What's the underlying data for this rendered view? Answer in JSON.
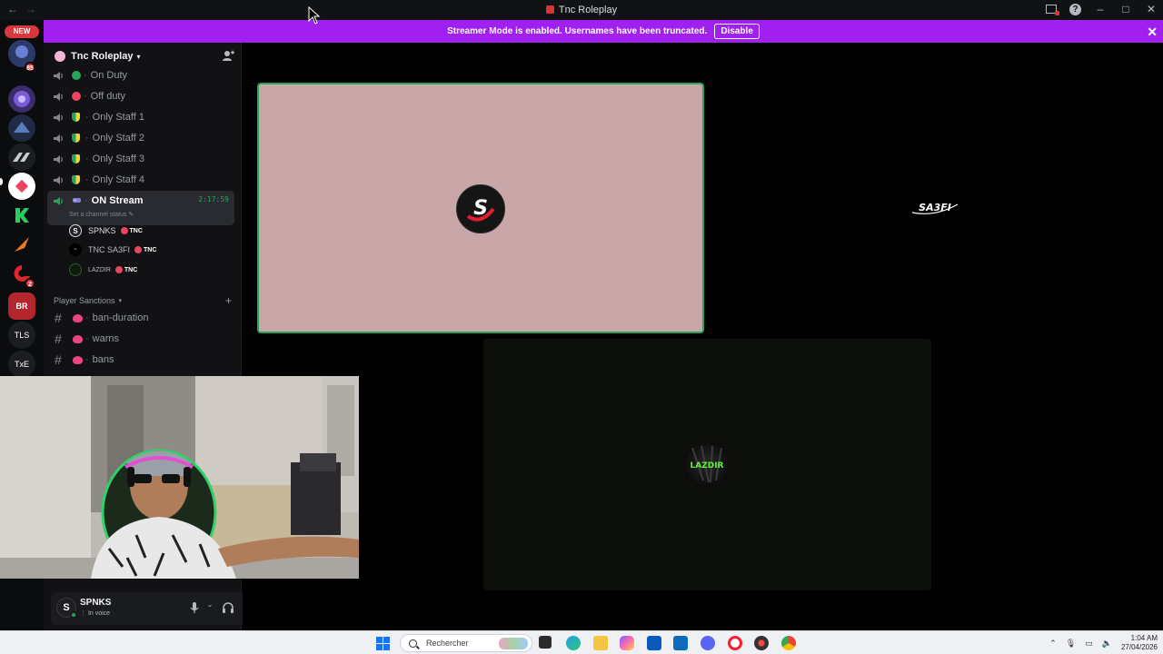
{
  "titlebar": {
    "title": "Tnc Roleplay",
    "back": "←",
    "forward": "→"
  },
  "banner": {
    "message": "Streamer Mode is enabled. Usernames have been truncated.",
    "disable_label": "Disable"
  },
  "rail": {
    "new_label": "NEW",
    "servers": [
      {
        "label": "",
        "color": "#2b3a67"
      },
      {
        "label": "",
        "color": "#3b2d6b"
      },
      {
        "label": "",
        "color": "#1f2b45"
      },
      {
        "label": "",
        "color": "#2a2d36"
      },
      {
        "label": "",
        "color": "#ffffff"
      },
      {
        "label": "",
        "color": "#1b1d21"
      },
      {
        "label": "",
        "color": "#1b1d21"
      },
      {
        "label": "",
        "color": "#1b1d21"
      },
      {
        "label": "",
        "color": "#1b1d21"
      },
      {
        "label": "BR",
        "color": "#b3262e"
      },
      {
        "label": "TLS",
        "color": "#1b1d21"
      },
      {
        "label": "TxE",
        "color": "#1b1d21"
      }
    ],
    "badges": [
      "85",
      "2"
    ]
  },
  "guild": {
    "name": "Tnc Roleplay"
  },
  "voice_channels": [
    {
      "name": "On Duty",
      "emoji_color": "#23a55a"
    },
    {
      "name": "Off duty",
      "emoji_color": "#e94560"
    },
    {
      "name": "Only Staff 1",
      "emoji_color": "#c7d62a"
    },
    {
      "name": "Only Staff 2",
      "emoji_color": "#c7d62a"
    },
    {
      "name": "Only Staff 3",
      "emoji_color": "#c7d62a"
    },
    {
      "name": "Only Staff 4",
      "emoji_color": "#c7d62a"
    }
  ],
  "active_channel": {
    "name": "ON Stream",
    "timer": "2:17:59",
    "status": "Set a channel status"
  },
  "voice_users": [
    {
      "name": "SPNKS",
      "tag": "TNC"
    },
    {
      "name": "TNC SA3FI",
      "tag": "TNC"
    },
    {
      "name": "LAZDIR",
      "tag": "TNC"
    }
  ],
  "category": {
    "name": "Player Sanctions"
  },
  "text_channels": [
    {
      "name": "ban-duration"
    },
    {
      "name": "warns"
    },
    {
      "name": "bans"
    }
  ],
  "user_panel": {
    "name": "SPNKS",
    "state": "In voice"
  },
  "stage": {
    "tile1_letter": "S",
    "tile2_label": "SA3FI",
    "tile3_label": "LAZDIR"
  },
  "taskbar": {
    "search_placeholder": "Rechercher",
    "time": "1:04 AM",
    "date": "27/04/2026"
  }
}
